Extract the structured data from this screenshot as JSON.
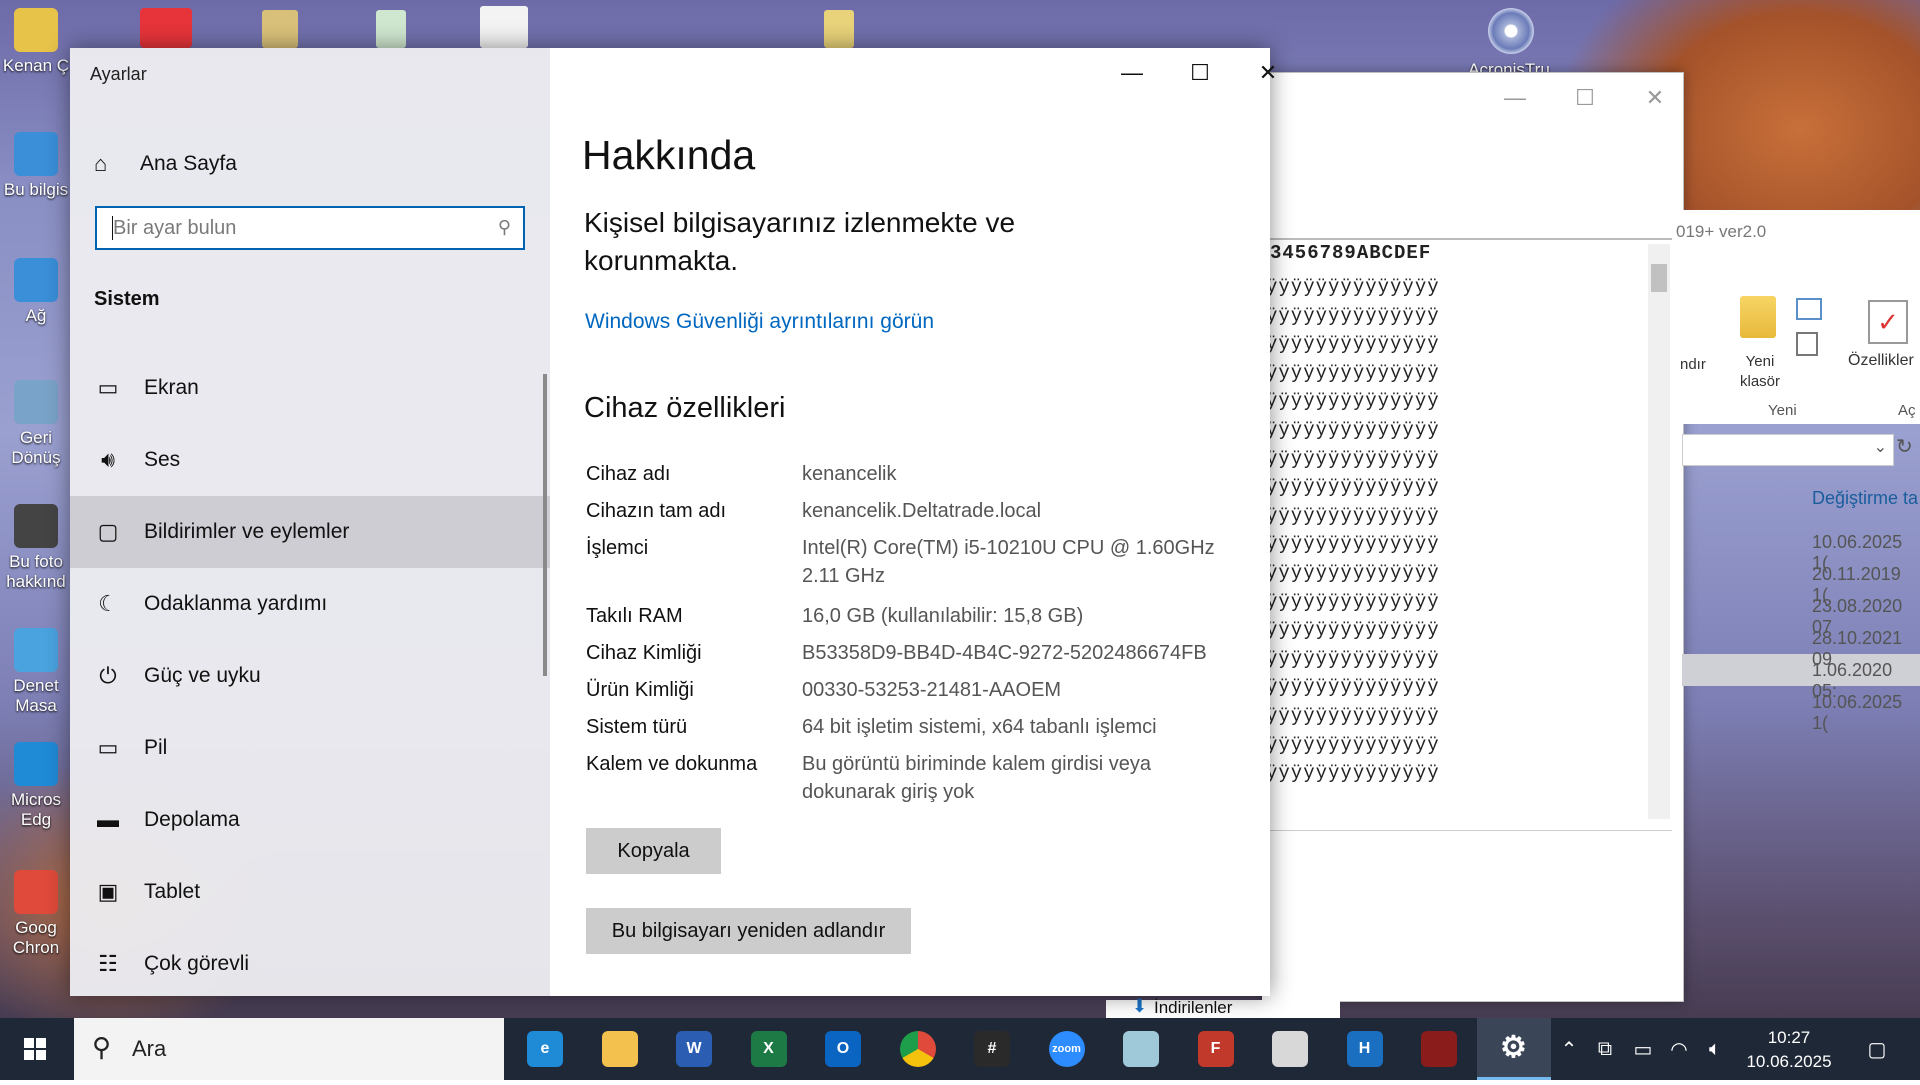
{
  "desktop": {
    "icons": [
      {
        "label": "Kenan Ç",
        "color": "#e8c34a"
      },
      {
        "label": "Bu bilgis",
        "color": "#3a8fd8"
      },
      {
        "label": "Ağ",
        "color": "#3a8fd8"
      },
      {
        "label": "Geri Dönüş",
        "color": "#7aa3c9"
      },
      {
        "label": "Bu foto hakkınd",
        "color": "#444444"
      },
      {
        "label": "Denet Masa",
        "color": "#4aa3df"
      },
      {
        "label": "Micros Edg",
        "color": "#1f8ad6"
      },
      {
        "label": "Goog Chron",
        "color": "#e04a3a"
      }
    ],
    "top_right_icon_label": "AcronisTru"
  },
  "explorer": {
    "hex_header": "3456789ABCDEF",
    "hex_row_text": "ÿÿÿÿÿÿÿÿÿÿÿÿÿÿ",
    "ribbon": {
      "version_text": "019+ ver2.0",
      "partial_label": "ndır",
      "new_folder": "Yeni klasör",
      "properties": "Özellikler",
      "group_new": "Yeni",
      "group_open": "Aç"
    },
    "column_header": "Değiştirme ta",
    "dates": [
      "10.06.2025 1(",
      "20.11.2019 1(",
      "23.08.2020 07",
      "28.10.2021 09",
      "1.06.2020 05:",
      "10.06.2025 1("
    ],
    "downloads": "İndirilenler"
  },
  "settings": {
    "window_title": "Ayarlar",
    "home": "Ana Sayfa",
    "search_placeholder": "Bir ayar bulun",
    "section": "Sistem",
    "nav": [
      {
        "label": "Ekran",
        "icon": "monitor-icon"
      },
      {
        "label": "Ses",
        "icon": "speaker-icon"
      },
      {
        "label": "Bildirimler ve eylemler",
        "icon": "notification-icon"
      },
      {
        "label": "Odaklanma yardımı",
        "icon": "moon-icon"
      },
      {
        "label": "Güç ve uyku",
        "icon": "power-icon"
      },
      {
        "label": "Pil",
        "icon": "battery-icon"
      },
      {
        "label": "Depolama",
        "icon": "storage-icon"
      },
      {
        "label": "Tablet",
        "icon": "tablet-icon"
      },
      {
        "label": "Çok görevli",
        "icon": "multitask-icon"
      }
    ],
    "page_title": "Hakkında",
    "protection_text": "Kişisel bilgisayarınız izlenmekte ve korunmakta.",
    "security_link": "Windows Güvenliği ayrıntılarını görün",
    "device_specs_title": "Cihaz özellikleri",
    "specs": [
      {
        "key": "Cihaz adı",
        "value": "kenancelik"
      },
      {
        "key": "Cihazın tam adı",
        "value": "kenancelik.Deltatrade.local"
      },
      {
        "key": "İşlemci",
        "value": "Intel(R) Core(TM) i5-10210U CPU @ 1.60GHz 2.11 GHz"
      },
      {
        "key": "Takılı RAM",
        "value": "16,0 GB (kullanılabilir: 15,8 GB)"
      },
      {
        "key": "Cihaz Kimliği",
        "value": "B53358D9-BB4D-4B4C-9272-5202486674FB"
      },
      {
        "key": "Ürün Kimliği",
        "value": "00330-53253-21481-AAOEM"
      },
      {
        "key": "Sistem türü",
        "value": "64 bit işletim sistemi, x64 tabanlı işlemci"
      },
      {
        "key": "Kalem ve dokunma",
        "value": "Bu görüntü biriminde kalem girdisi veya dokunarak giriş yok"
      }
    ],
    "copy_button": "Kopyala",
    "rename_button": "Bu bilgisayarı yeniden adlandır"
  },
  "taskbar": {
    "search_text": "Ara",
    "apps": [
      {
        "name": "edge",
        "glyph": "e",
        "color": "#1f8ad6"
      },
      {
        "name": "file-explorer",
        "glyph": "",
        "color": "#f2c14e"
      },
      {
        "name": "word",
        "glyph": "W",
        "color": "#2b5eb3"
      },
      {
        "name": "excel",
        "glyph": "X",
        "color": "#1e7a45"
      },
      {
        "name": "outlook",
        "glyph": "O",
        "color": "#0a64c2"
      },
      {
        "name": "chrome",
        "glyph": "",
        "color": "#e04a3a"
      },
      {
        "name": "network-tool",
        "glyph": "#",
        "color": "#2a2a2a"
      },
      {
        "name": "zoom",
        "glyph": "zoom",
        "color": "#2d8cff"
      },
      {
        "name": "notepad",
        "glyph": "",
        "color": "#9fc9d8"
      },
      {
        "name": "filezilla",
        "glyph": "F",
        "color": "#c0392b"
      },
      {
        "name": "snipping",
        "glyph": "",
        "color": "#d8d8d8"
      },
      {
        "name": "h-app",
        "glyph": "H",
        "color": "#1a6fc0"
      },
      {
        "name": "game",
        "glyph": "",
        "color": "#8a1c1c"
      },
      {
        "name": "settings",
        "glyph": "⚙",
        "color": "#3a4557"
      }
    ],
    "time": "10:27",
    "date": "10.06.2025"
  }
}
